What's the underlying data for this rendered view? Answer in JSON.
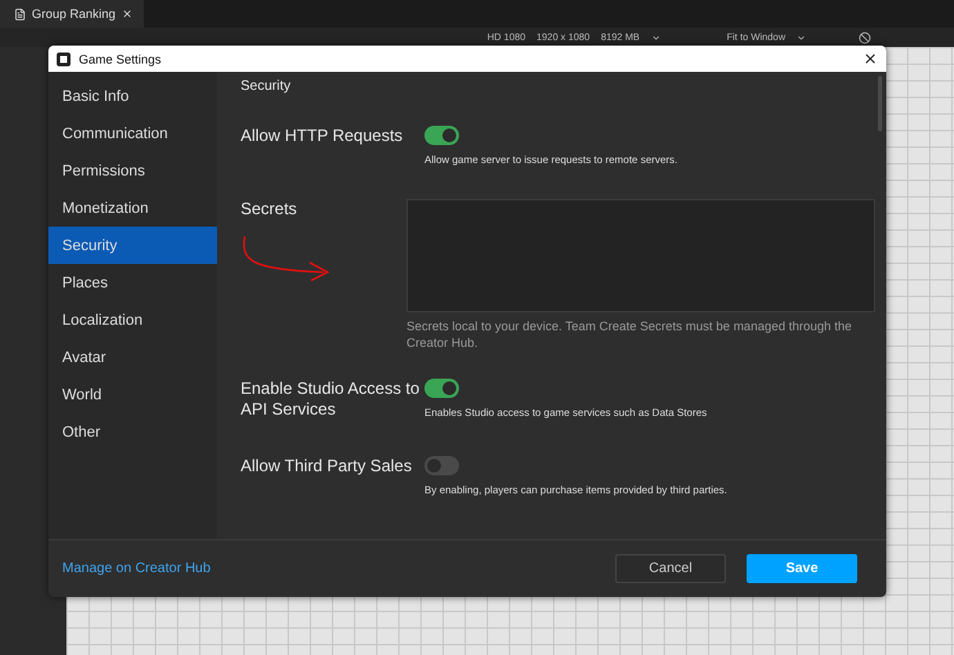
{
  "tab": {
    "title": "Group Ranking"
  },
  "toolbar": {
    "items": [
      "HD 1080",
      "1920 x 1080",
      "8192 MB"
    ],
    "fit": "Fit to Window"
  },
  "dialog": {
    "title": "Game Settings",
    "sidebar": [
      {
        "label": "Basic Info",
        "selected": false
      },
      {
        "label": "Communication",
        "selected": false
      },
      {
        "label": "Permissions",
        "selected": false
      },
      {
        "label": "Monetization",
        "selected": false
      },
      {
        "label": "Security",
        "selected": true
      },
      {
        "label": "Places",
        "selected": false
      },
      {
        "label": "Localization",
        "selected": false
      },
      {
        "label": "Avatar",
        "selected": false
      },
      {
        "label": "World",
        "selected": false
      },
      {
        "label": "Other",
        "selected": false
      }
    ],
    "section_title": "Security",
    "settings": [
      {
        "kind": "toggle",
        "label": "Allow HTTP Requests",
        "on": true,
        "description": "Allow game server to issue requests to remote servers."
      },
      {
        "kind": "textbox",
        "label": "Secrets",
        "description": "Secrets local to your device. Team Create Secrets must be managed through the Creator Hub."
      },
      {
        "kind": "toggle",
        "label": "Enable Studio Access to API Services",
        "on": true,
        "description": "Enables Studio access to game services such as Data Stores"
      },
      {
        "kind": "toggle",
        "label": "Allow Third Party Sales",
        "on": false,
        "description": "By enabling, players can purchase items provided by third parties."
      }
    ],
    "footer": {
      "link": "Manage on Creator Hub",
      "buttons": [
        {
          "label": "Cancel",
          "kind": "secondary"
        },
        {
          "label": "Save",
          "kind": "primary"
        }
      ]
    }
  }
}
